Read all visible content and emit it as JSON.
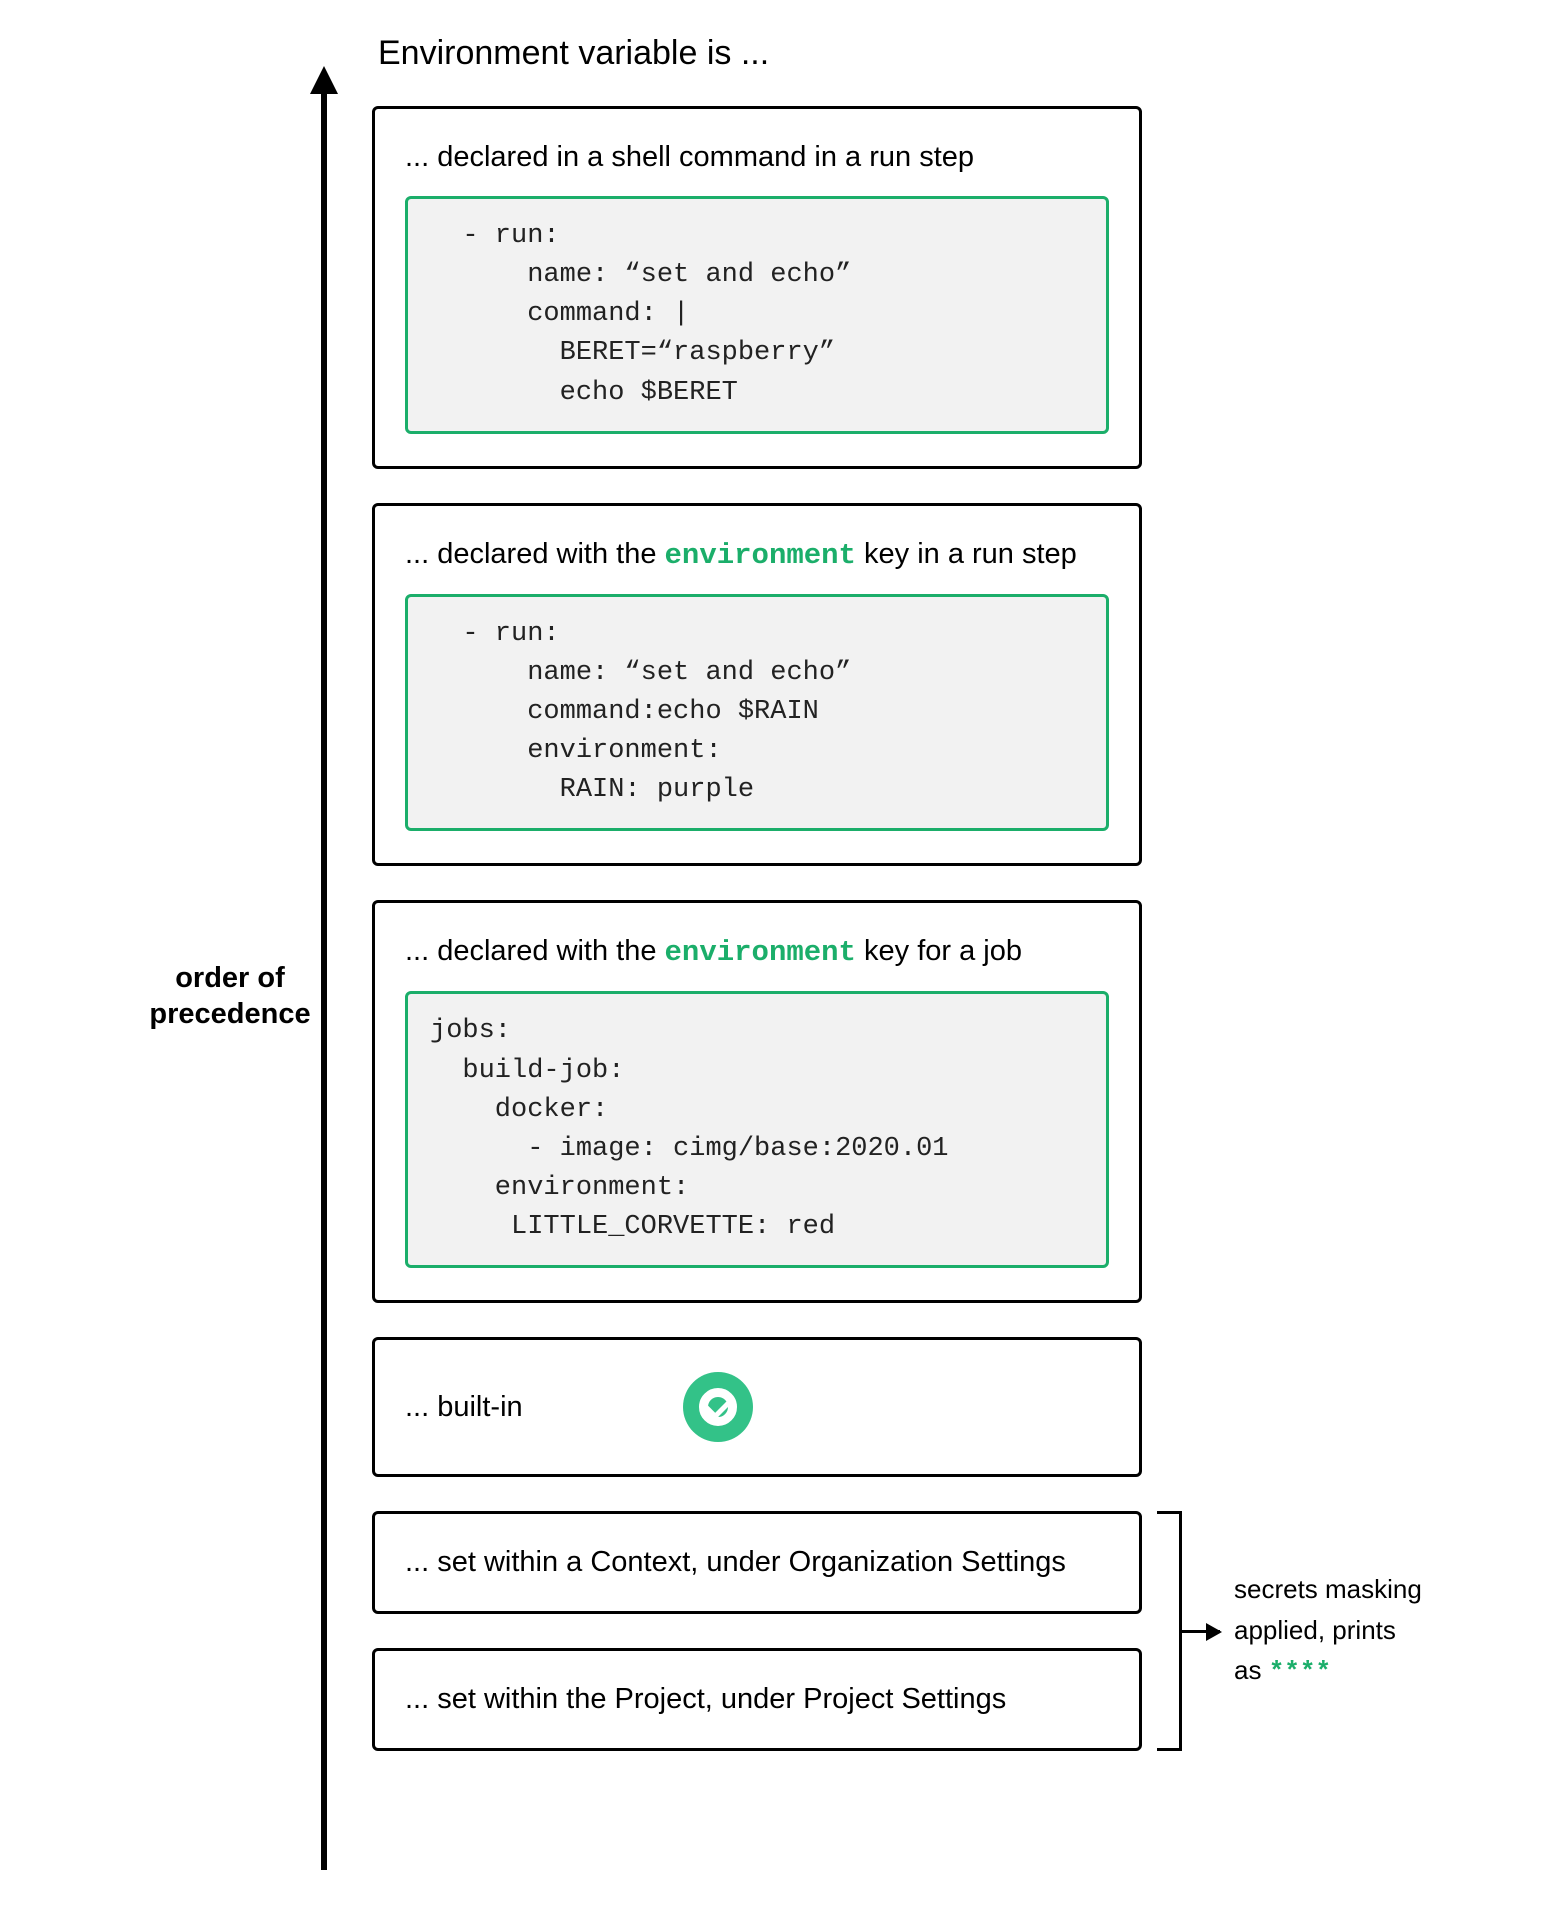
{
  "heading": "Environment variable is ...",
  "axis_label_line1": "order of",
  "axis_label_line2": "precedence",
  "boxes": {
    "shell": {
      "desc": "... declared in a shell command in a run step",
      "code": "  - run:\n      name: “set and echo”\n      command: |\n        BERET=“raspberry”\n        echo $BERET"
    },
    "run_env": {
      "desc_pre": "... declared with the ",
      "desc_kw": "environment",
      "desc_post": " key in a run step",
      "code": "  - run:\n      name: “set and echo”\n      command:echo $RAIN\n      environment:\n        RAIN: purple"
    },
    "job_env": {
      "desc_pre": "... declared with the ",
      "desc_kw": "environment",
      "desc_post": " key for a job",
      "code": "jobs:\n  build-job:\n    docker:\n      - image: cimg/base:2020.01\n    environment:\n     LITTLE_CORVETTE: red"
    },
    "builtin": {
      "desc": "... built-in"
    },
    "context": {
      "desc": "... set within a Context, under Organization Settings"
    },
    "project": {
      "desc": "... set within the Project, under Project Settings"
    }
  },
  "side_note": {
    "line1": "secrets masking",
    "line2_pre": "applied, prints",
    "line3_pre": "as ",
    "mask": "****"
  }
}
